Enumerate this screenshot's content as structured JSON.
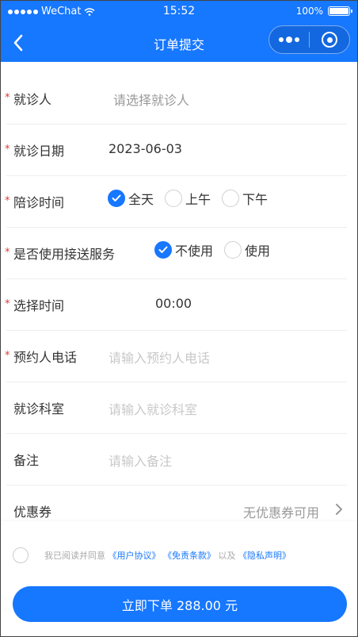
{
  "status_bar": {
    "carrier": "WeChat",
    "time": "15:52",
    "battery": "100%"
  },
  "nav": {
    "title": "订单提交"
  },
  "form": {
    "patient": {
      "label": "就诊人",
      "placeholder": "请选择就诊人",
      "required": true
    },
    "visit_date": {
      "label": "就诊日期",
      "value": "2023-06-03",
      "required": true
    },
    "escort_time": {
      "label": "陪诊时间",
      "required": true,
      "options": [
        "全天",
        "上午",
        "下午"
      ],
      "selected": "全天"
    },
    "shuttle": {
      "label": "是否使用接送服务",
      "required": true,
      "options": [
        "不使用",
        "使用"
      ],
      "selected": "不使用"
    },
    "select_time": {
      "label": "选择时间",
      "value": "00:00",
      "required": true
    },
    "booker_phone": {
      "label": "预约人电话",
      "placeholder": "请输入预约人电话",
      "required": true
    },
    "department": {
      "label": "就诊科室",
      "placeholder": "请输入就诊科室",
      "required": false
    },
    "remarks": {
      "label": "备注",
      "placeholder": "请输入备注",
      "required": false
    },
    "coupon": {
      "label": "优惠券",
      "value": "无优惠券可用"
    }
  },
  "agreement": {
    "prefix": "我已阅读并同意",
    "user_agreement": "《用户协议》",
    "disclaimer": "《免责条款》",
    "and": "以及",
    "privacy": "《隐私声明》"
  },
  "submit": {
    "label": "立即下单 288.00 元"
  },
  "colors": {
    "primary": "#1677ff",
    "required_mark": "#e53935"
  }
}
